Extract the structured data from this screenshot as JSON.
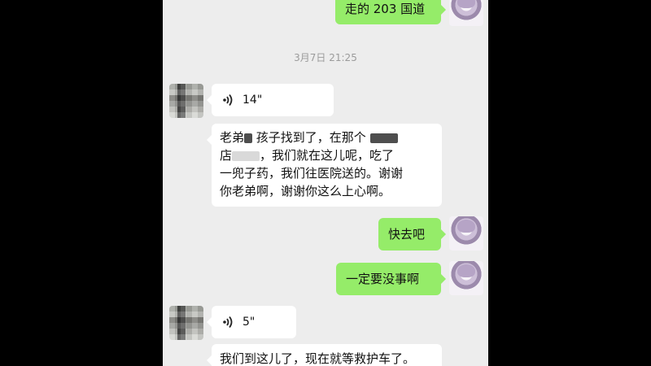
{
  "chat": {
    "timestamp": "3月7日 21:25",
    "messages": [
      {
        "side": "right",
        "type": "text",
        "text": "走的 203 国道"
      },
      {
        "side": "left",
        "type": "voice",
        "duration": "14\""
      },
      {
        "side": "left",
        "type": "text",
        "line1_a": "老弟",
        "line1_b": "孩子找到了，在那个",
        "line2_a": "店",
        "line2_b": "，我们就在这儿呢，吃了",
        "line3": "一兜子药，我们往医院送的。谢谢",
        "line4": "你老弟啊，谢谢你这么上心啊。"
      },
      {
        "side": "right",
        "type": "text",
        "text": "快去吧"
      },
      {
        "side": "right",
        "type": "text",
        "text": "一定要没事啊"
      },
      {
        "side": "left",
        "type": "voice",
        "duration": "5\""
      },
      {
        "side": "left",
        "type": "text",
        "text": "我们到这儿了，现在就等救护车了。"
      }
    ]
  },
  "colors": {
    "chat_bg": "#ededed",
    "self_bubble": "#95ec69",
    "other_bubble": "#ffffff",
    "timestamp": "#9b9b9b"
  },
  "icons": [
    "voice-wave-icon"
  ]
}
